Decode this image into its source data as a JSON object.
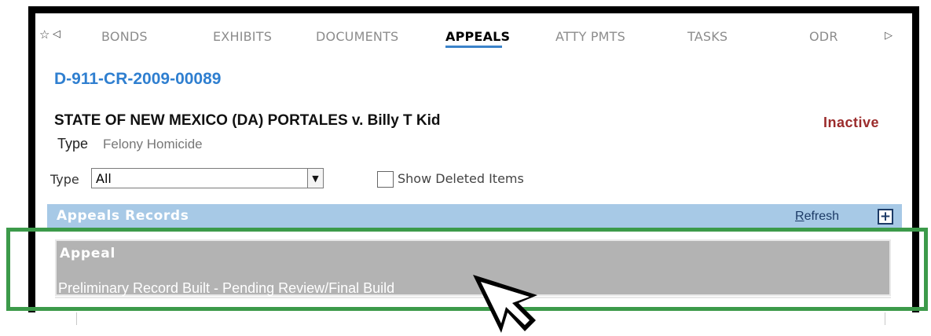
{
  "tabs": {
    "items": [
      {
        "label": "BONDS",
        "active": false
      },
      {
        "label": "EXHIBITS",
        "active": false
      },
      {
        "label": "DOCUMENTS",
        "active": false
      },
      {
        "label": "APPEALS",
        "active": true
      },
      {
        "label": "ATTY PMTS",
        "active": false
      },
      {
        "label": "TASKS",
        "active": false
      },
      {
        "label": "ODR",
        "active": false
      }
    ],
    "left_icons": [
      "star-icon",
      "left-arrow-icon"
    ],
    "right_icon": "right-arrow-icon",
    "active_underline_color": "#3a82c9"
  },
  "case": {
    "number": "D-911-CR-2009-00089",
    "title": "STATE OF NEW MEXICO (DA) PORTALES v. Billy T Kid",
    "type_label": "Type",
    "type_value": "Felony Homicide",
    "status": "Inactive",
    "number_color": "#2f7fd0",
    "status_color": "#9b2b2b"
  },
  "filter": {
    "type_label": "Type",
    "type_selected": "All",
    "show_deleted_label": "Show Deleted Items",
    "show_deleted_checked": false
  },
  "appeals": {
    "header": "Appeals Records",
    "refresh_label_first": "R",
    "refresh_label_rest": "efresh",
    "add_icon": "plus-box-icon",
    "header_color": "#a7c9e6",
    "records": [
      {
        "title": "Appeal",
        "status": "Preliminary Record Built - Pending Review/Final Build"
      }
    ]
  },
  "annotations": {
    "highlight_color": "#3c9a4a",
    "cursor_icon": "mouse-pointer-icon"
  }
}
